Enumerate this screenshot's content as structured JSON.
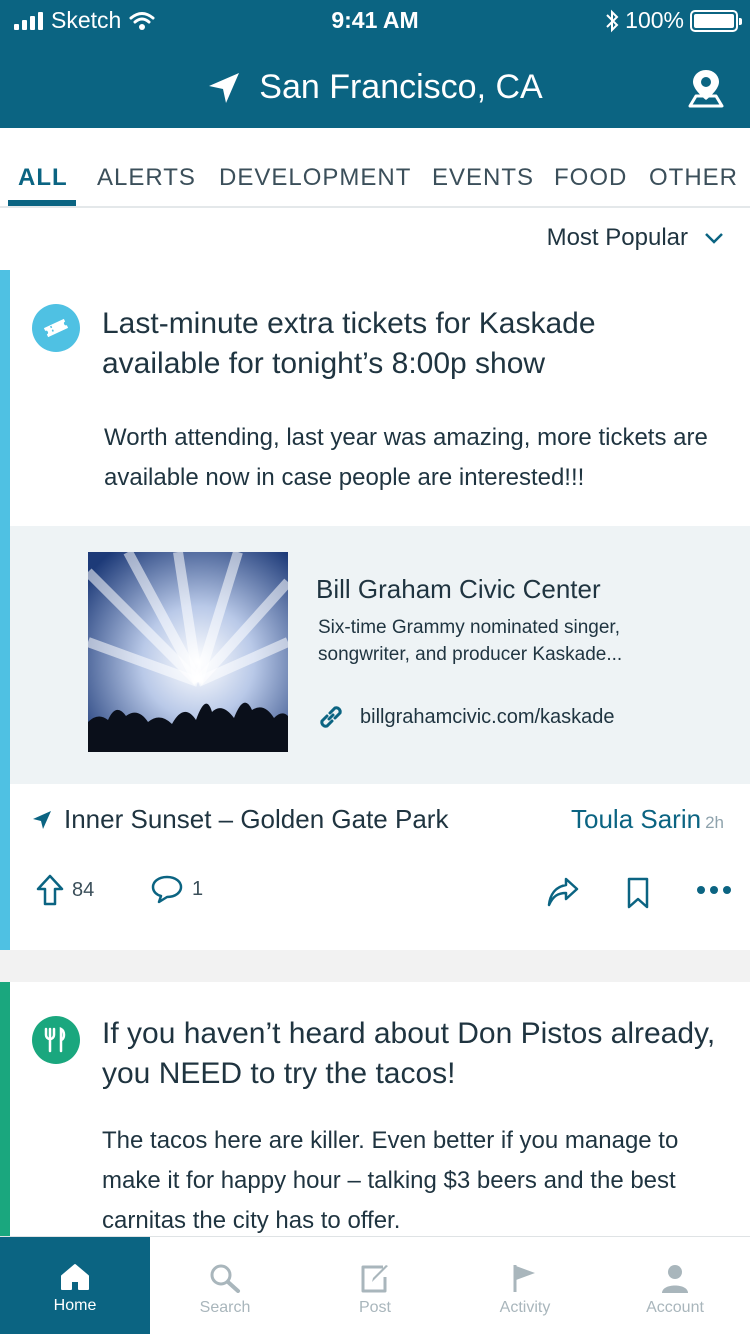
{
  "status_bar": {
    "carrier": "Sketch",
    "time": "9:41 AM",
    "battery": "100%"
  },
  "header": {
    "location": "San Francisco, CA"
  },
  "tabs": [
    {
      "label": "ALL",
      "active": true
    },
    {
      "label": "ALERTS"
    },
    {
      "label": "DEVELOPMENT"
    },
    {
      "label": "EVENTS"
    },
    {
      "label": "FOOD"
    },
    {
      "label": "OTHER"
    }
  ],
  "sort": {
    "label": "Most Popular"
  },
  "posts": [
    {
      "category_icon": "ticket-icon",
      "accent_color": "#4fc1e3",
      "title": "Last-minute extra tickets for Kaskade available for tonight’s 8:00p show",
      "body": "Worth attending, last year was amazing, more tickets are available now in case people are interested!!!",
      "link": {
        "title": "Bill Graham Civic Center",
        "description": "Six-time Grammy nominated singer, songwriter, and producer Kaskade...",
        "url": "billgrahamcivic.com/kaskade"
      },
      "location": "Inner Sunset – Golden Gate Park",
      "author": "Toula Sarin",
      "time_ago": "2h",
      "upvotes": "84",
      "comments": "1"
    },
    {
      "category_icon": "fork-knife-icon",
      "accent_color": "#1aa77e",
      "title": "If you haven’t heard about Don Pistos already, you NEED to try the tacos!",
      "body": "The tacos here are killer. Even better if you manage to make it for happy hour – talking $3 beers and the best carnitas the city has to offer."
    }
  ],
  "tabbar": [
    {
      "label": "Home",
      "icon": "home-icon",
      "active": true
    },
    {
      "label": "Search",
      "icon": "search-icon"
    },
    {
      "label": "Post",
      "icon": "compose-icon"
    },
    {
      "label": "Activity",
      "icon": "flag-icon"
    },
    {
      "label": "Account",
      "icon": "account-icon"
    }
  ],
  "colors": {
    "brand": "#0b6482",
    "events": "#4fc1e3",
    "food": "#1aa77e"
  }
}
